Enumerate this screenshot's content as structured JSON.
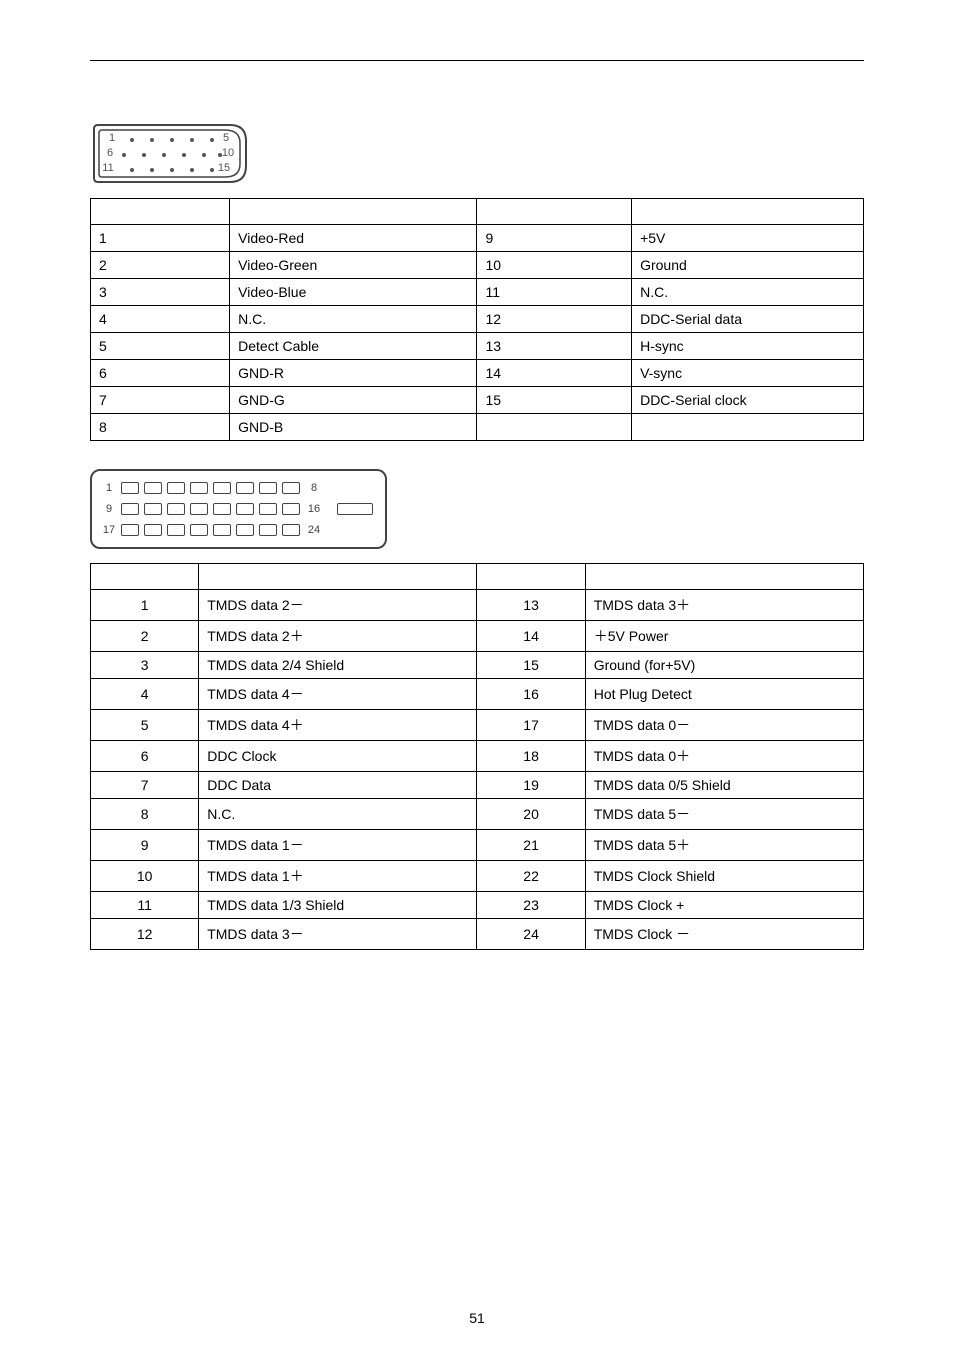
{
  "page_number": "51",
  "vga_diagram": {
    "labels": [
      "1",
      "5",
      "6",
      "10",
      "11",
      "15"
    ]
  },
  "dvi_diagram": {
    "labels": [
      "1",
      "8",
      "9",
      "16",
      "17",
      "24"
    ]
  },
  "table1": {
    "headers": [
      "",
      "",
      "",
      ""
    ],
    "rows": [
      [
        "1",
        "Video-Red",
        "9",
        "+5V"
      ],
      [
        "2",
        "Video-Green",
        "10",
        "Ground"
      ],
      [
        "3",
        "Video-Blue",
        "11",
        "N.C."
      ],
      [
        "4",
        "N.C.",
        "12",
        "DDC-Serial data"
      ],
      [
        "5",
        "Detect Cable",
        "13",
        "H-sync"
      ],
      [
        "6",
        "GND-R",
        "14",
        "V-sync"
      ],
      [
        "7",
        "GND-G",
        "15",
        "DDC-Serial clock"
      ],
      [
        "8",
        "GND-B",
        "",
        ""
      ]
    ]
  },
  "table2": {
    "headers": [
      "",
      "",
      "",
      ""
    ],
    "rows": [
      [
        "1",
        "TMDS data 2－",
        "13",
        "TMDS data 3＋"
      ],
      [
        "2",
        "TMDS data 2＋",
        "14",
        "＋5V Power"
      ],
      [
        "3",
        "TMDS data 2/4 Shield",
        "15",
        "Ground (for+5V)"
      ],
      [
        "4",
        "TMDS data 4－",
        "16",
        "Hot Plug Detect"
      ],
      [
        "5",
        "TMDS data 4＋",
        "17",
        "TMDS data 0－"
      ],
      [
        "6",
        "DDC Clock",
        "18",
        "TMDS data 0＋"
      ],
      [
        "7",
        "DDC Data",
        "19",
        "TMDS data 0/5 Shield"
      ],
      [
        "8",
        "N.C.",
        "20",
        "TMDS data 5－"
      ],
      [
        "9",
        "TMDS data 1－",
        "21",
        "TMDS data 5＋"
      ],
      [
        "10",
        "TMDS data 1＋",
        "22",
        "TMDS Clock Shield"
      ],
      [
        "11",
        "TMDS data 1/3 Shield",
        "23",
        "TMDS Clock +"
      ],
      [
        "12",
        "TMDS data 3－",
        "24",
        "TMDS Clock －"
      ]
    ]
  }
}
